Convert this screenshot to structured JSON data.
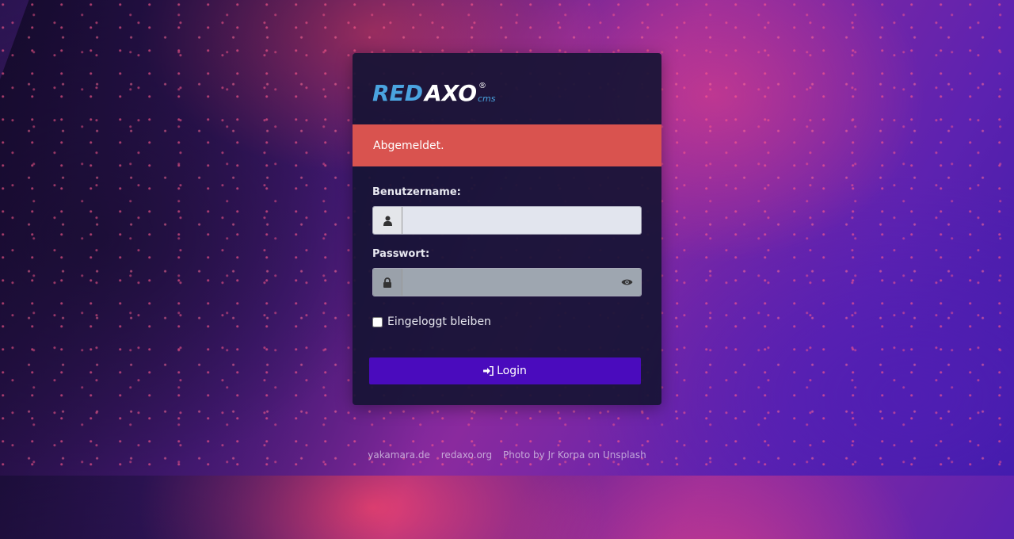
{
  "logo": {
    "text": "REDAXO",
    "suffix": "cms",
    "mark": "®"
  },
  "alert": {
    "message": "Abgemeldet."
  },
  "form": {
    "username_label": "Benutzername:",
    "username_value": "",
    "password_label": "Passwort:",
    "password_value": "",
    "remember_label": "Eingeloggt bleiben",
    "remember_checked": false,
    "login_label": "Login"
  },
  "footer": {
    "links": [
      "yakamara.de",
      "redaxo.org",
      "Photo by Jr Korpa on Unsplash"
    ]
  },
  "colors": {
    "alert_bg": "#d9534f",
    "button_bg": "#4a0bbd",
    "card_bg": "#161434",
    "logo_blue": "#4aa3df"
  },
  "icons": [
    "user-icon",
    "lock-icon",
    "eye-icon",
    "sign-in-icon"
  ]
}
